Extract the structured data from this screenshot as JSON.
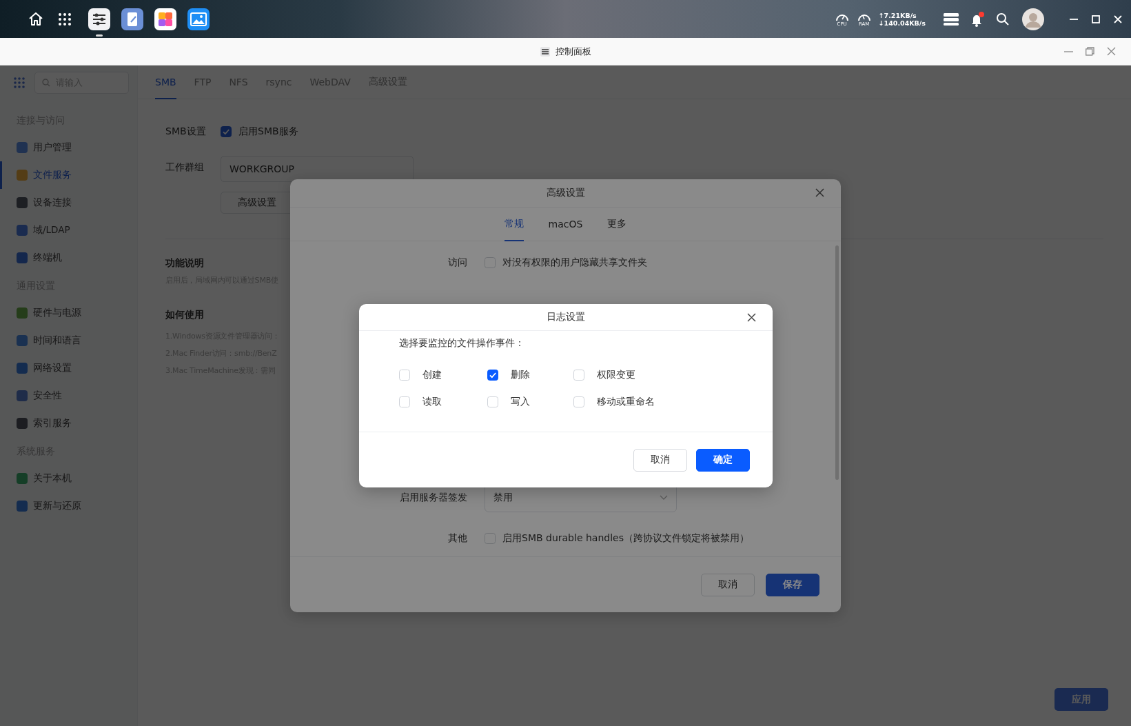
{
  "top_bar": {
    "apps": [
      {
        "selected": true
      },
      {
        "selected": false
      },
      {
        "selected": false
      },
      {
        "selected": false
      }
    ],
    "cpu_label": "CPU",
    "ram_label": "RAM",
    "upload": "↑7.21KB/s",
    "download": "↓140.04KB/s"
  },
  "window": {
    "title": "控制面板"
  },
  "sidebar": {
    "search_placeholder": "请输入",
    "sections": [
      {
        "header": "连接与访问",
        "items": [
          {
            "label": "用户管理",
            "selected": false
          },
          {
            "label": "文件服务",
            "selected": true
          },
          {
            "label": "设备连接",
            "selected": false
          },
          {
            "label": "域/LDAP",
            "selected": false
          },
          {
            "label": "终端机",
            "selected": false
          }
        ]
      },
      {
        "header": "通用设置",
        "items": [
          {
            "label": "硬件与电源",
            "selected": false
          },
          {
            "label": "时间和语言",
            "selected": false
          },
          {
            "label": "网络设置",
            "selected": false
          },
          {
            "label": "安全性",
            "selected": false
          },
          {
            "label": "索引服务",
            "selected": false
          }
        ]
      },
      {
        "header": "系统服务",
        "items": [
          {
            "label": "关于本机",
            "selected": false
          },
          {
            "label": "更新与还原",
            "selected": false
          }
        ]
      }
    ]
  },
  "tabs": [
    {
      "label": "SMB",
      "selected": true
    },
    {
      "label": "FTP",
      "selected": false
    },
    {
      "label": "NFS",
      "selected": false
    },
    {
      "label": "rsync",
      "selected": false
    },
    {
      "label": "WebDAV",
      "selected": false
    },
    {
      "label": "高级设置",
      "selected": false
    }
  ],
  "smb_form": {
    "service_label": "SMB设置",
    "service_checkbox": {
      "label": "启用SMB服务",
      "checked": true
    },
    "workgroup_label": "工作群组",
    "workgroup_value": "WORKGROUP",
    "advanced_button": "高级设置"
  },
  "info": {
    "feature_heading": "功能说明",
    "feature_text": "启用后，局域网内可以通过SMB使",
    "usage_heading": "如何使用",
    "usage_lines": [
      "1.Windows资源文件管理器访问：",
      "2.Mac Finder访问：smb://BenZ",
      "3.Mac TimeMachine发现：需同"
    ]
  },
  "apply_button": "应用",
  "advanced_dialog": {
    "title": "高级设置",
    "tabs": [
      {
        "label": "常规",
        "selected": true
      },
      {
        "label": "macOS",
        "selected": false
      },
      {
        "label": "更多",
        "selected": false
      }
    ],
    "rows": [
      {
        "kind": "checkbox",
        "label": "访问",
        "text": "对没有权限的用户隐藏共享文件夹",
        "checked": false
      },
      {
        "kind": "select",
        "label": "启用服务器签发",
        "value": "禁用"
      },
      {
        "kind": "checkbox",
        "label": "其他",
        "text": "启用SMB durable handles（跨协议文件锁定将被禁用）",
        "checked": false
      }
    ],
    "cancel_button": "取消",
    "save_button": "保存"
  },
  "log_dialog": {
    "title": "日志设置",
    "prompt": "选择要监控的文件操作事件：",
    "options": [
      {
        "label": "创建",
        "checked": false
      },
      {
        "label": "删除",
        "checked": true
      },
      {
        "label": "权限变更",
        "checked": false
      },
      {
        "label": "读取",
        "checked": false
      },
      {
        "label": "写入",
        "checked": false
      },
      {
        "label": "移动或重命名",
        "checked": false
      }
    ],
    "cancel_button": "取消",
    "ok_button": "确定"
  }
}
